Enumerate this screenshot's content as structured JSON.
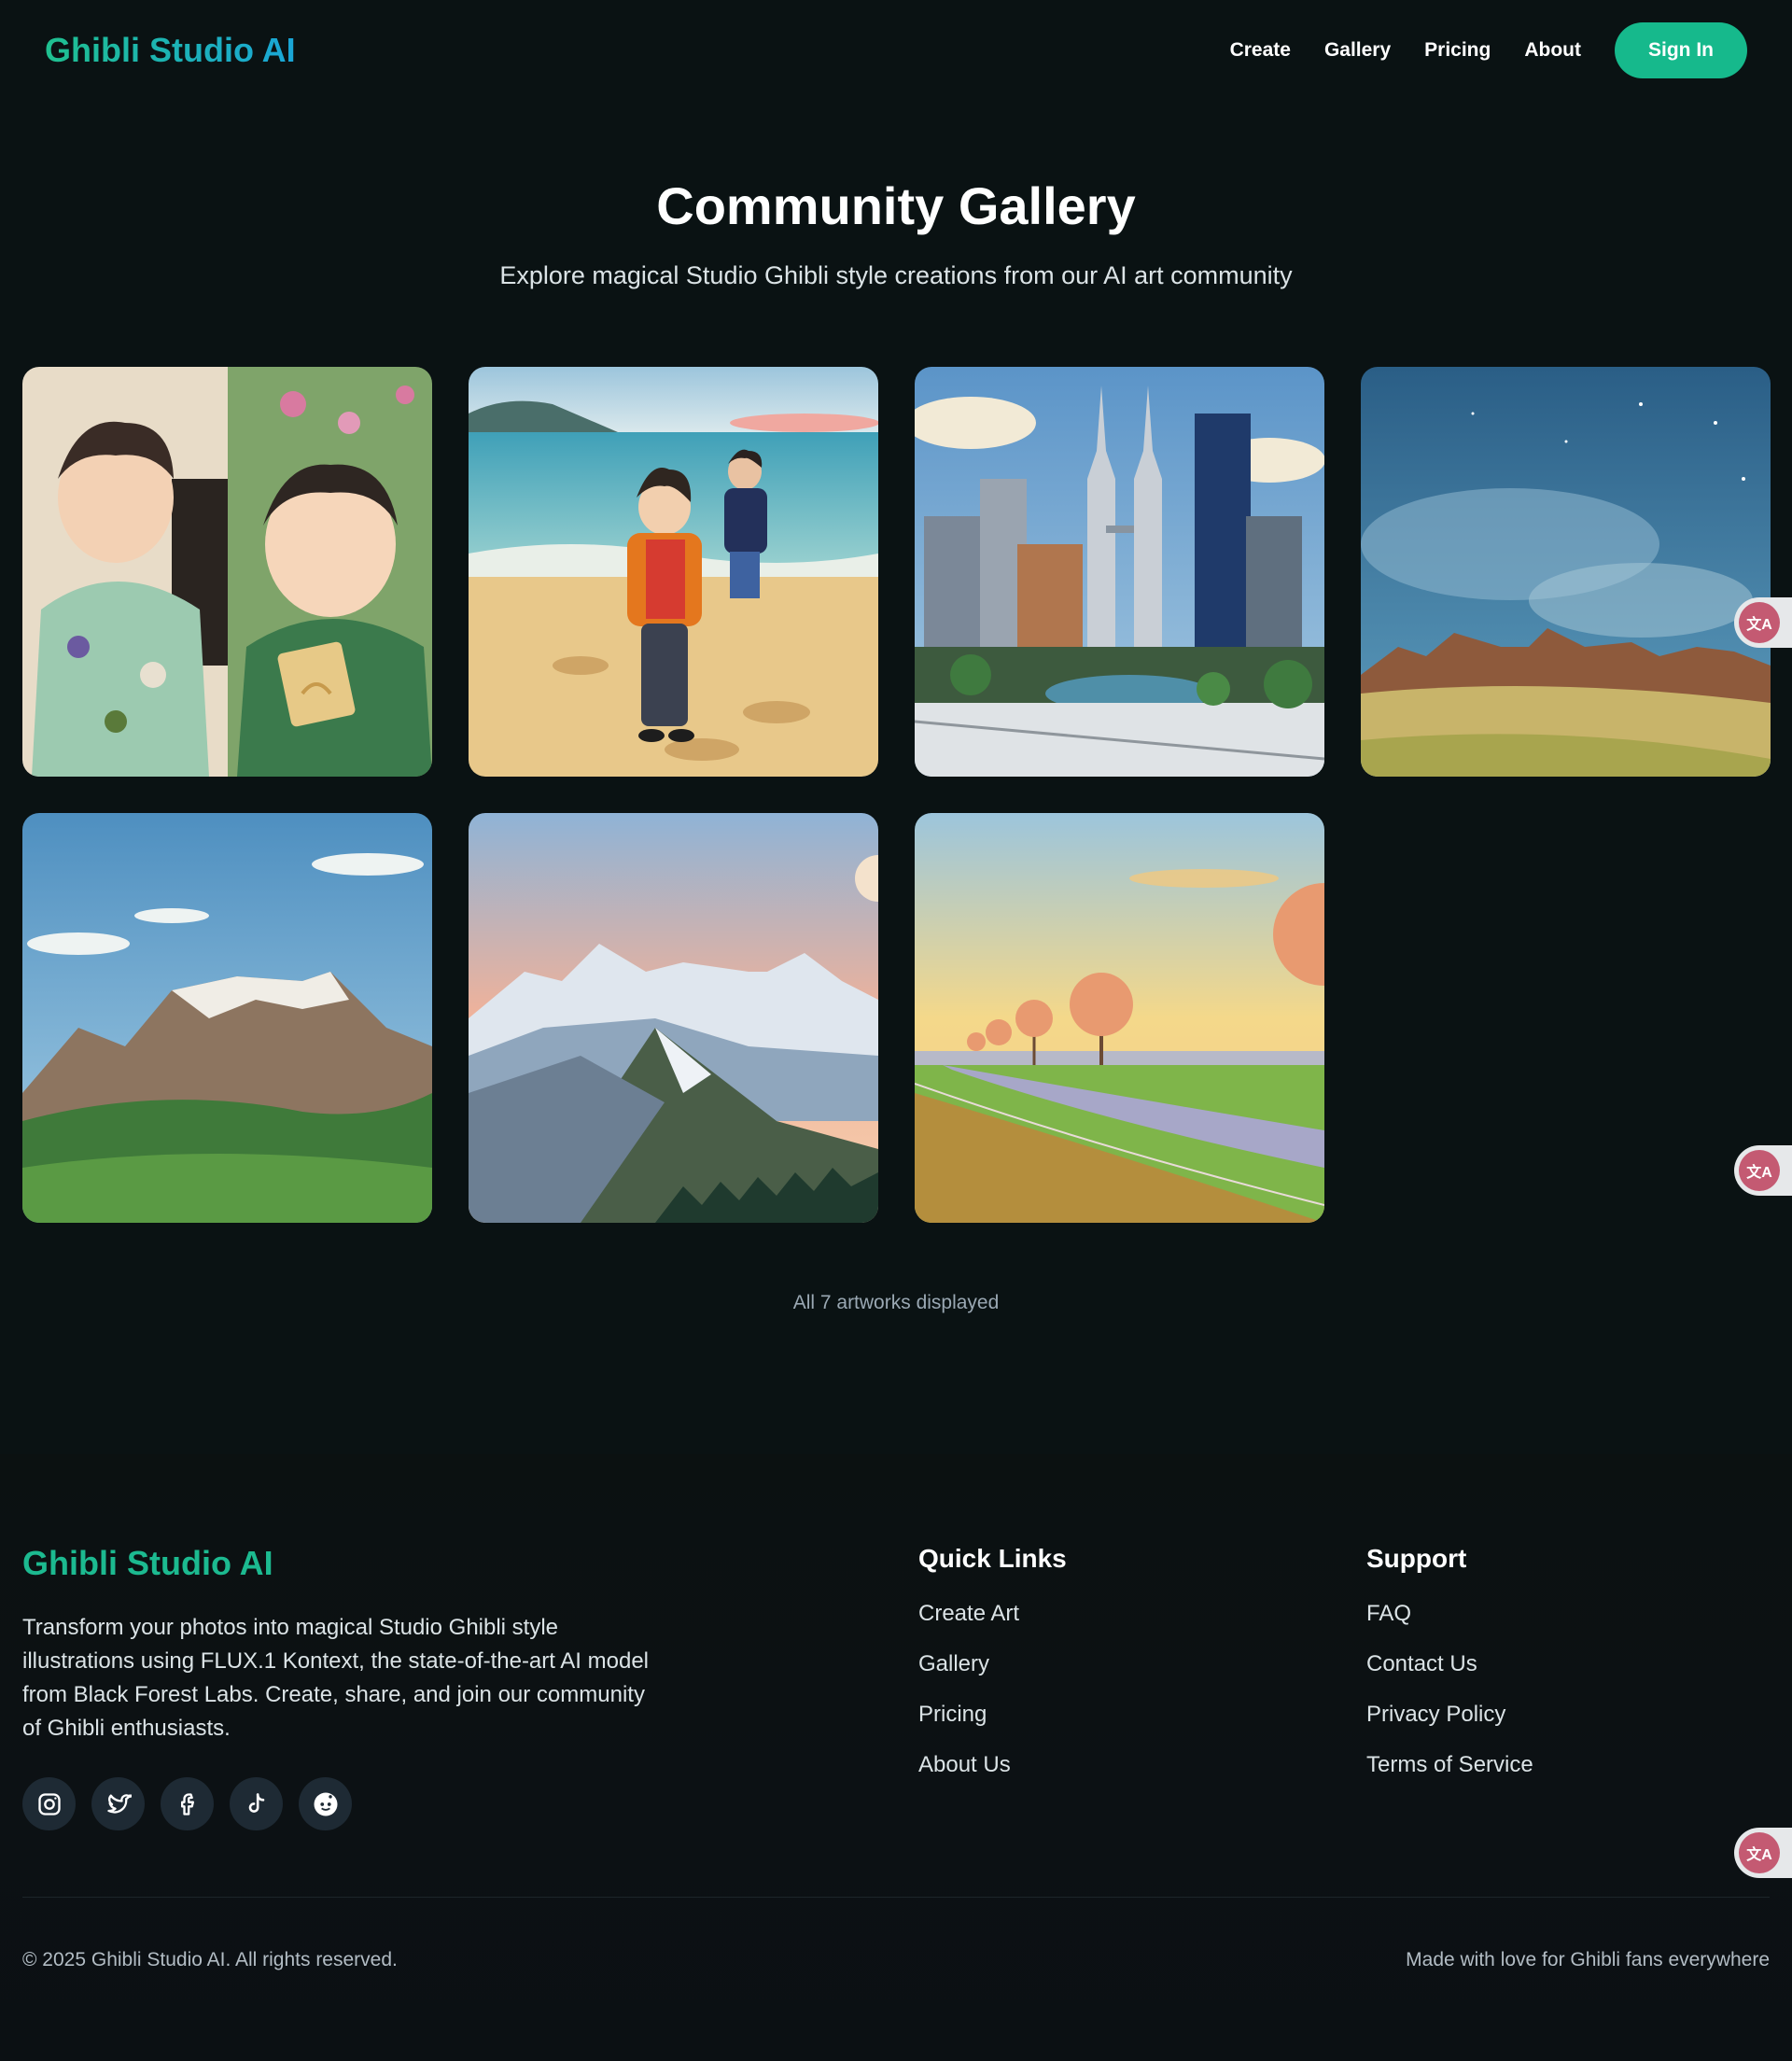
{
  "header": {
    "logo": "Ghibli Studio AI",
    "nav": [
      "Create",
      "Gallery",
      "Pricing",
      "About"
    ],
    "sign_in": "Sign In"
  },
  "hero": {
    "title": "Community Gallery",
    "subtitle": "Explore magical Studio Ghibli style creations from our AI art community"
  },
  "gallery": {
    "status": "All 7 artworks displayed"
  },
  "footer": {
    "brand": "Ghibli Studio AI",
    "description": "Transform your photos into magical Studio Ghibli style illustrations using FLUX.1 Kontext, the state-of-the-art AI model from Black Forest Labs. Create, share, and join our community of Ghibli enthusiasts.",
    "socials": [
      "instagram-icon",
      "twitter-icon",
      "facebook-icon",
      "tiktok-icon",
      "reddit-icon"
    ],
    "quick_links": {
      "title": "Quick Links",
      "items": [
        "Create Art",
        "Gallery",
        "Pricing",
        "About Us"
      ]
    },
    "support": {
      "title": "Support",
      "items": [
        "FAQ",
        "Contact Us",
        "Privacy Policy",
        "Terms of Service"
      ]
    },
    "copyright": "© 2025 Ghibli Studio AI. All rights reserved.",
    "tagline": "Made with love for Ghibli fans everywhere"
  },
  "floating": {
    "translate_label": "文A"
  },
  "colors": {
    "background": "#0a1213",
    "accent": "#16b98c",
    "logo_gradient_end": "#1aa6d8"
  }
}
